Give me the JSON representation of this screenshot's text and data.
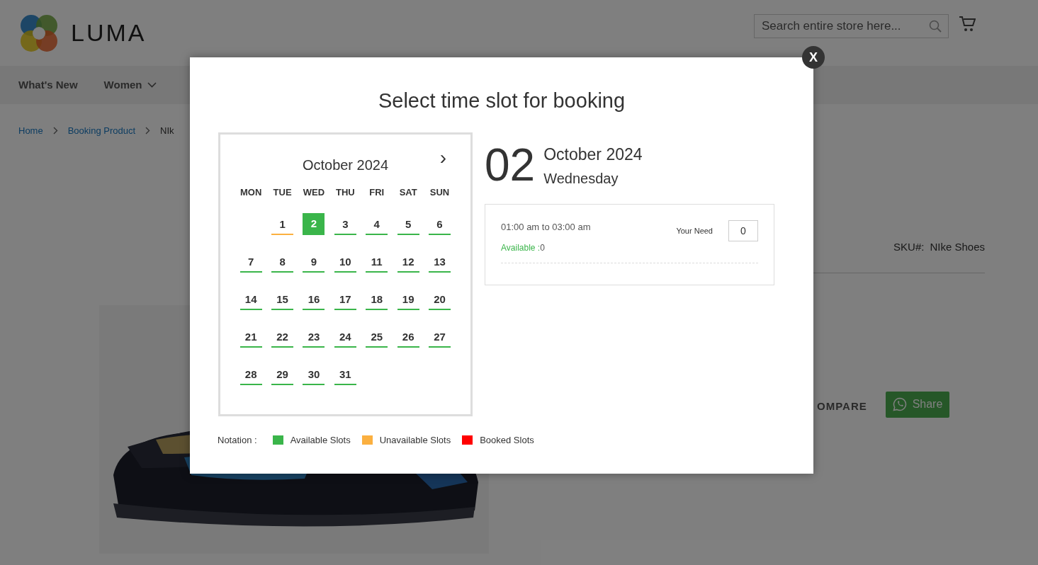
{
  "header": {
    "logo_text": "LUMA",
    "search": {
      "placeholder": "Search entire store here..."
    }
  },
  "nav": [
    {
      "label": "What's New",
      "has_menu": false
    },
    {
      "label": "Women",
      "has_menu": true
    }
  ],
  "breadcrumbs": [
    "Home",
    "Booking Product",
    "NIk"
  ],
  "product": {
    "sku_label": "SKU#:",
    "sku": "NIke Shoes",
    "compare": "OMPARE",
    "share": "Share"
  },
  "modal": {
    "title": "Select time slot for booking",
    "close": "X",
    "calendar": {
      "month": "October 2024",
      "next": "›",
      "weekdays": [
        "MON",
        "TUE",
        "WED",
        "THU",
        "FRI",
        "SAT",
        "SUN"
      ],
      "weeks": [
        [
          {
            "label": "1",
            "color": "#fbb040",
            "selected": false
          },
          {
            "label": "2",
            "color": "#3ab54a",
            "selected": true
          },
          {
            "label": "3",
            "color": "#3ab54a",
            "selected": false
          },
          {
            "label": "4",
            "color": "#3ab54a",
            "selected": false
          },
          {
            "label": "5",
            "color": "#3ab54a",
            "selected": false
          },
          {
            "label": "6",
            "color": "#3ab54a",
            "selected": false
          }
        ],
        [
          {
            "label": "7",
            "color": "#3ab54a",
            "selected": false
          },
          {
            "label": "8",
            "color": "#3ab54a",
            "selected": false
          },
          {
            "label": "9",
            "color": "#3ab54a",
            "selected": false
          },
          {
            "label": "10",
            "color": "#3ab54a",
            "selected": false
          },
          {
            "label": "11",
            "color": "#3ab54a",
            "selected": false
          },
          {
            "label": "12",
            "color": "#3ab54a",
            "selected": false
          },
          {
            "label": "13",
            "color": "#3ab54a",
            "selected": false
          }
        ],
        [
          {
            "label": "14",
            "color": "#3ab54a",
            "selected": false
          },
          {
            "label": "15",
            "color": "#3ab54a",
            "selected": false
          },
          {
            "label": "16",
            "color": "#3ab54a",
            "selected": false
          },
          {
            "label": "17",
            "color": "#3ab54a",
            "selected": false
          },
          {
            "label": "18",
            "color": "#3ab54a",
            "selected": false
          },
          {
            "label": "19",
            "color": "#3ab54a",
            "selected": false
          },
          {
            "label": "20",
            "color": "#3ab54a",
            "selected": false
          }
        ],
        [
          {
            "label": "21",
            "color": "#3ab54a",
            "selected": false
          },
          {
            "label": "22",
            "color": "#3ab54a",
            "selected": false
          },
          {
            "label": "23",
            "color": "#3ab54a",
            "selected": false
          },
          {
            "label": "24",
            "color": "#3ab54a",
            "selected": false
          },
          {
            "label": "25",
            "color": "#3ab54a",
            "selected": false
          },
          {
            "label": "26",
            "color": "#3ab54a",
            "selected": false
          },
          {
            "label": "27",
            "color": "#3ab54a",
            "selected": false
          }
        ],
        [
          {
            "label": "28",
            "color": "#3ab54a",
            "selected": false
          },
          {
            "label": "29",
            "color": "#3ab54a",
            "selected": false
          },
          {
            "label": "30",
            "color": "#3ab54a",
            "selected": false
          },
          {
            "label": "31",
            "color": "#3ab54a",
            "selected": false
          }
        ]
      ]
    },
    "selected_date": {
      "day": "02",
      "month": "October 2024",
      "weekday": "Wednesday"
    },
    "slots": [
      {
        "time": "01:00 am to 03:00 am",
        "available_label": "Available :",
        "available_count": "0",
        "need_label": "Your Need",
        "need_value": "0"
      }
    ],
    "notation": {
      "label": "Notation :",
      "items": [
        {
          "label": "Available Slots",
          "color": "#3ab54a"
        },
        {
          "label": "Unavailable Slots",
          "color": "#fbb040"
        },
        {
          "label": "Booked Slots",
          "color": "#ff0000"
        }
      ]
    }
  }
}
